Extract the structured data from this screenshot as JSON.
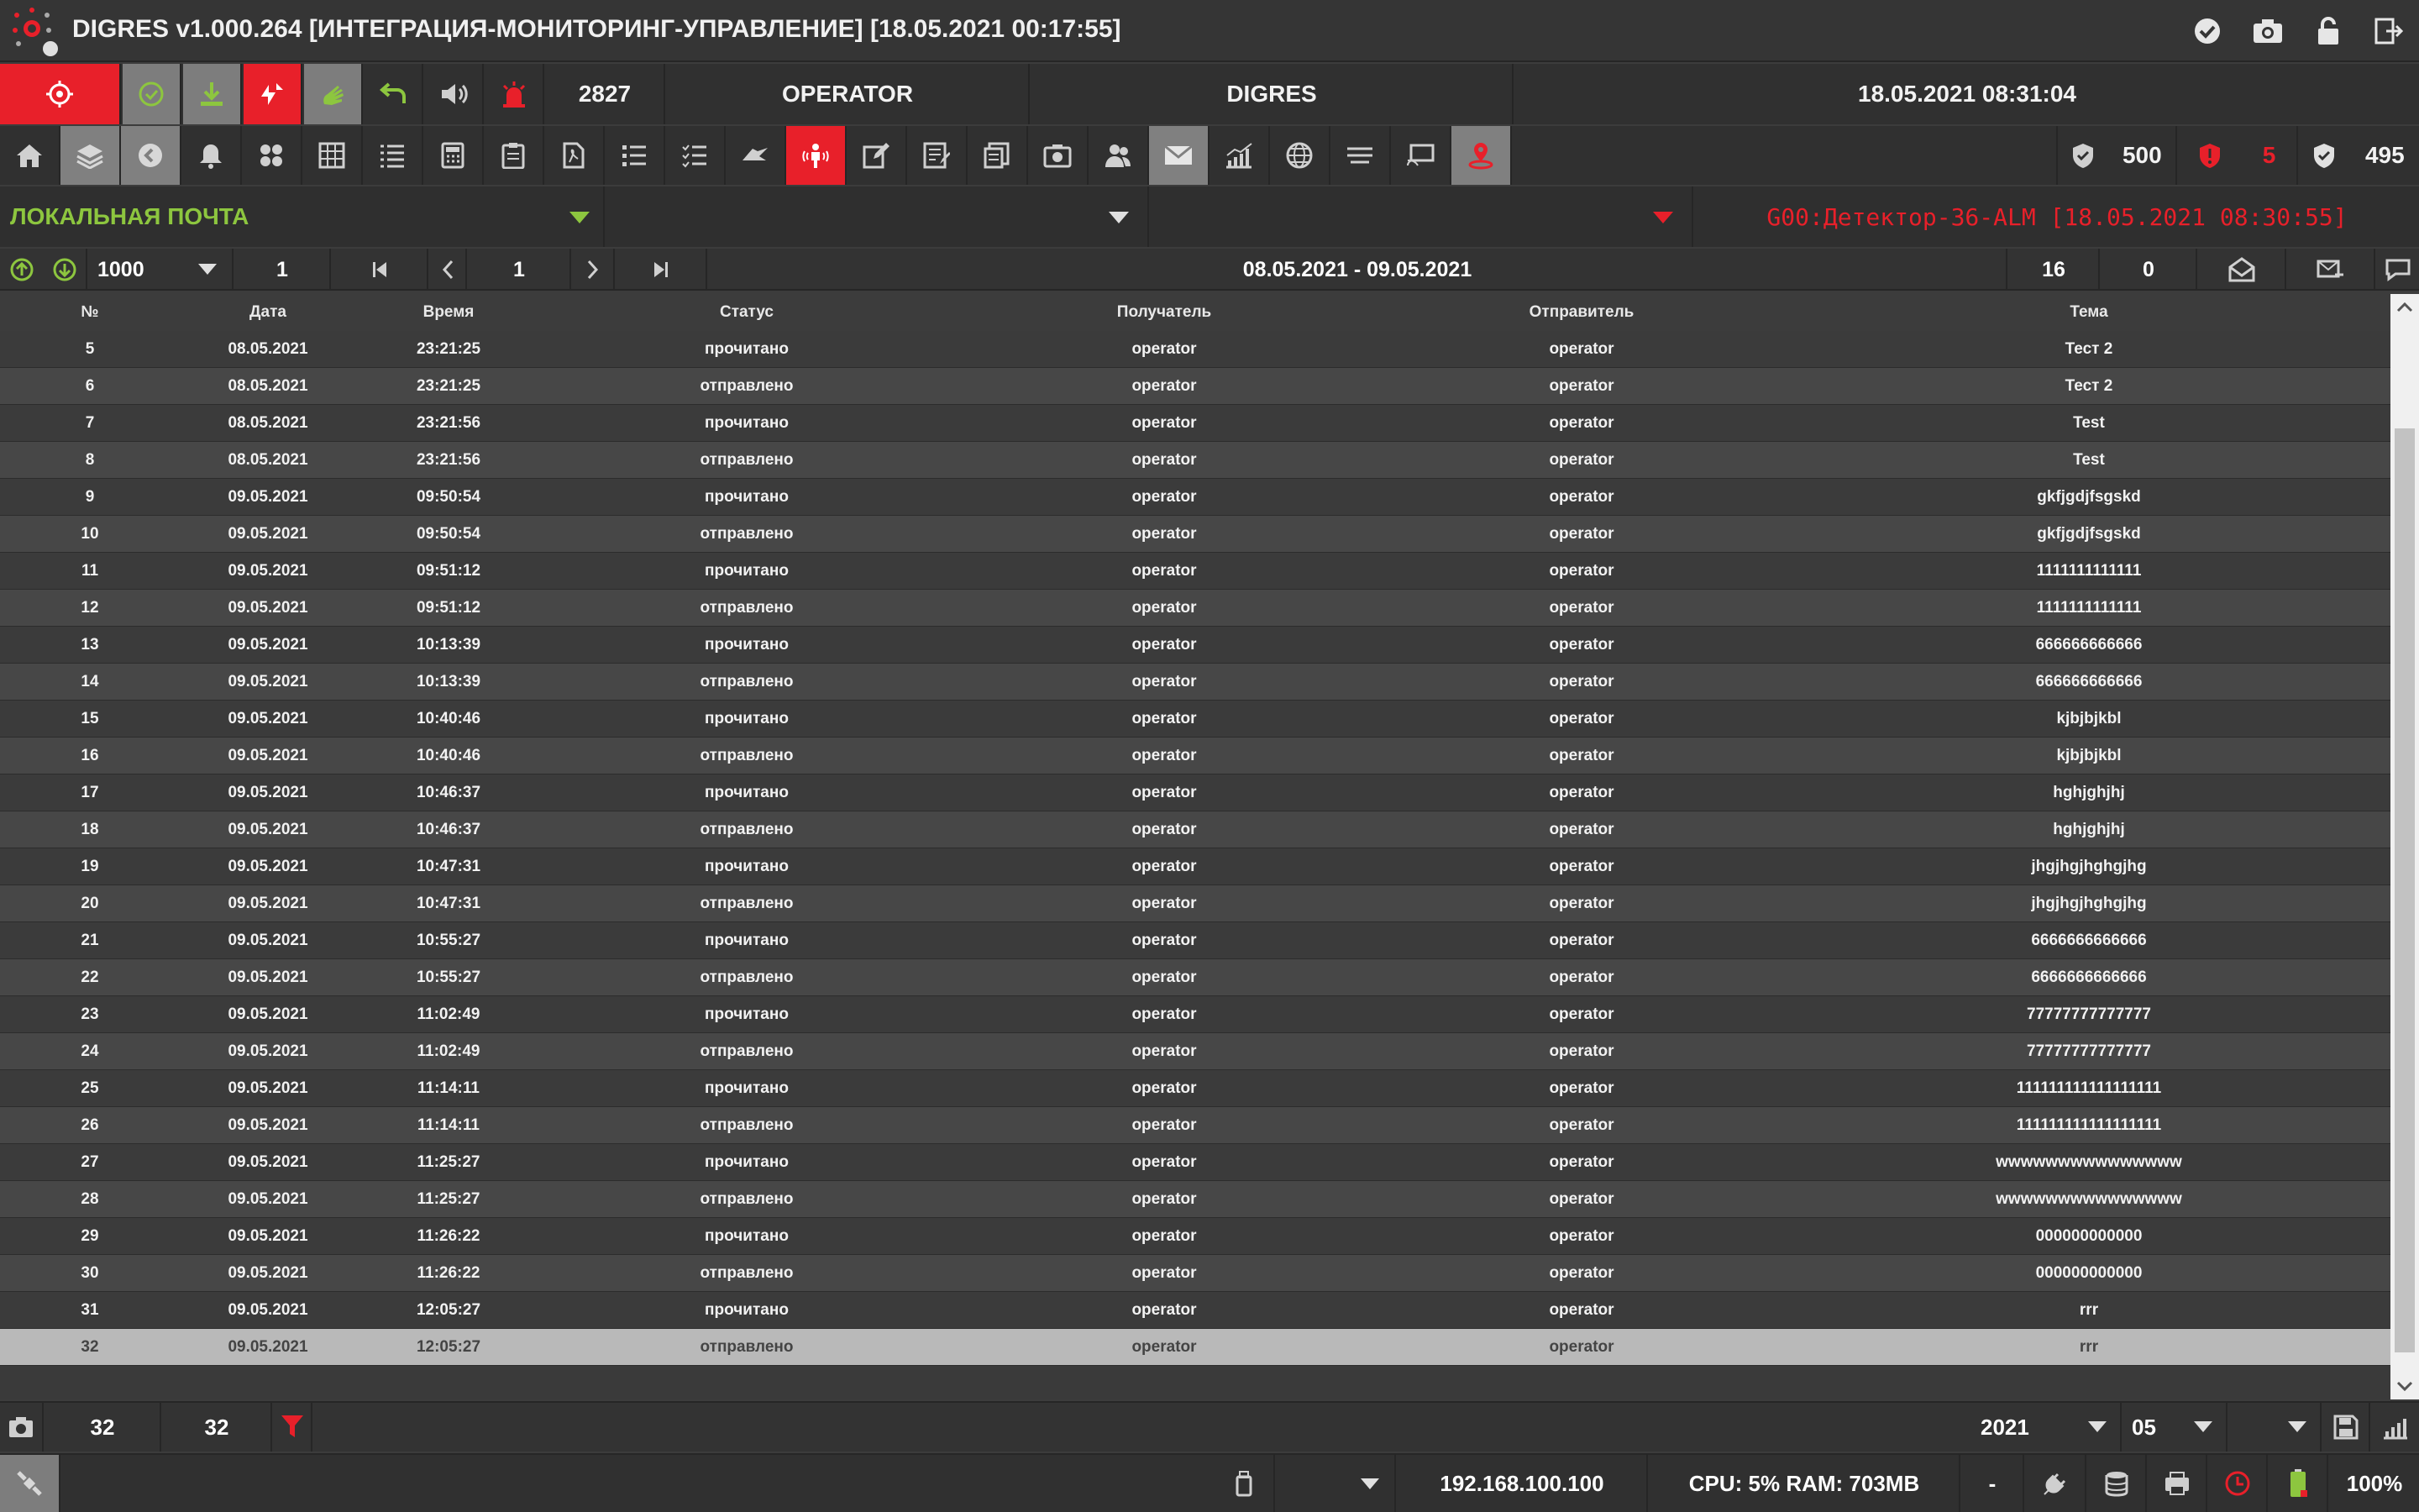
{
  "window": {
    "title": "DIGRES v1.000.264 [ИНТЕГРАЦИЯ-МОНИТОРИНГ-УПРАВЛЕНИЕ] [18.05.2021 00:17:55]"
  },
  "status": {
    "counter": "2827",
    "user": "OPERATOR",
    "system": "DIGRES",
    "datetime": "18.05.2021 08:31:04"
  },
  "stats": {
    "total": "500",
    "alarms": "5",
    "ok": "495"
  },
  "mail": {
    "folder": "ЛОКАЛЬНАЯ ПОЧТА",
    "alarm_text": "G00:Детектор-36-ALM [18.05.2021 08:30:55]"
  },
  "pager": {
    "page_size": "1000",
    "page_from": "1",
    "page_current": "1",
    "date_range": "08.05.2021 - 09.05.2021",
    "count_a": "16",
    "count_b": "0"
  },
  "table": {
    "columns": {
      "num": "№",
      "date": "Дата",
      "time": "Время",
      "status": "Статус",
      "recipient": "Получатель",
      "sender": "Отправитель",
      "subject": "Тема"
    },
    "rows": [
      [
        "5",
        "08.05.2021",
        "23:21:25",
        "прочитано",
        "operator",
        "operator",
        "Тест 2"
      ],
      [
        "6",
        "08.05.2021",
        "23:21:25",
        "отправлено",
        "operator",
        "operator",
        "Тест 2"
      ],
      [
        "7",
        "08.05.2021",
        "23:21:56",
        "прочитано",
        "operator",
        "operator",
        "Test"
      ],
      [
        "8",
        "08.05.2021",
        "23:21:56",
        "отправлено",
        "operator",
        "operator",
        "Test"
      ],
      [
        "9",
        "09.05.2021",
        "09:50:54",
        "прочитано",
        "operator",
        "operator",
        "gkfjgdjfsgskd"
      ],
      [
        "10",
        "09.05.2021",
        "09:50:54",
        "отправлено",
        "operator",
        "operator",
        "gkfjgdjfsgskd"
      ],
      [
        "11",
        "09.05.2021",
        "09:51:12",
        "прочитано",
        "operator",
        "operator",
        "1111111111111"
      ],
      [
        "12",
        "09.05.2021",
        "09:51:12",
        "отправлено",
        "operator",
        "operator",
        "1111111111111"
      ],
      [
        "13",
        "09.05.2021",
        "10:13:39",
        "прочитано",
        "operator",
        "operator",
        "666666666666"
      ],
      [
        "14",
        "09.05.2021",
        "10:13:39",
        "отправлено",
        "operator",
        "operator",
        "666666666666"
      ],
      [
        "15",
        "09.05.2021",
        "10:40:46",
        "прочитано",
        "operator",
        "operator",
        "kjbjbjkbl"
      ],
      [
        "16",
        "09.05.2021",
        "10:40:46",
        "отправлено",
        "operator",
        "operator",
        "kjbjbjkbl"
      ],
      [
        "17",
        "09.05.2021",
        "10:46:37",
        "прочитано",
        "operator",
        "operator",
        "hghjghjhj"
      ],
      [
        "18",
        "09.05.2021",
        "10:46:37",
        "отправлено",
        "operator",
        "operator",
        "hghjghjhj"
      ],
      [
        "19",
        "09.05.2021",
        "10:47:31",
        "прочитано",
        "operator",
        "operator",
        "jhgjhgjhghgjhg"
      ],
      [
        "20",
        "09.05.2021",
        "10:47:31",
        "отправлено",
        "operator",
        "operator",
        "jhgjhgjhghgjhg"
      ],
      [
        "21",
        "09.05.2021",
        "10:55:27",
        "прочитано",
        "operator",
        "operator",
        "6666666666666"
      ],
      [
        "22",
        "09.05.2021",
        "10:55:27",
        "отправлено",
        "operator",
        "operator",
        "6666666666666"
      ],
      [
        "23",
        "09.05.2021",
        "11:02:49",
        "прочитано",
        "operator",
        "operator",
        "77777777777777"
      ],
      [
        "24",
        "09.05.2021",
        "11:02:49",
        "отправлено",
        "operator",
        "operator",
        "77777777777777"
      ],
      [
        "25",
        "09.05.2021",
        "11:14:11",
        "прочитано",
        "operator",
        "operator",
        "111111111111111111"
      ],
      [
        "26",
        "09.05.2021",
        "11:14:11",
        "отправлено",
        "operator",
        "operator",
        "111111111111111111"
      ],
      [
        "27",
        "09.05.2021",
        "11:25:27",
        "прочитано",
        "operator",
        "operator",
        "wwwwwwwwwwwwwww"
      ],
      [
        "28",
        "09.05.2021",
        "11:25:27",
        "отправлено",
        "operator",
        "operator",
        "wwwwwwwwwwwwwww"
      ],
      [
        "29",
        "09.05.2021",
        "11:26:22",
        "прочитано",
        "operator",
        "operator",
        "000000000000"
      ],
      [
        "30",
        "09.05.2021",
        "11:26:22",
        "отправлено",
        "operator",
        "operator",
        "000000000000"
      ],
      [
        "31",
        "09.05.2021",
        "12:05:27",
        "прочитано",
        "operator",
        "operator",
        "rrr"
      ],
      [
        "32",
        "09.05.2021",
        "12:05:27",
        "отправлено",
        "operator",
        "operator",
        "rrr"
      ]
    ]
  },
  "footer": {
    "count_a": "32",
    "count_b": "32",
    "year": "2021",
    "month": "05"
  },
  "statusbar": {
    "dash": "-",
    "ip": "192.168.100.100",
    "cpu_ram": "CPU: 5% RAM: 703MB",
    "zoom": "100%"
  },
  "colors": {
    "accent_red": "#e8202a",
    "accent_green": "#8dc63f",
    "bg": "#3c3c3c"
  }
}
